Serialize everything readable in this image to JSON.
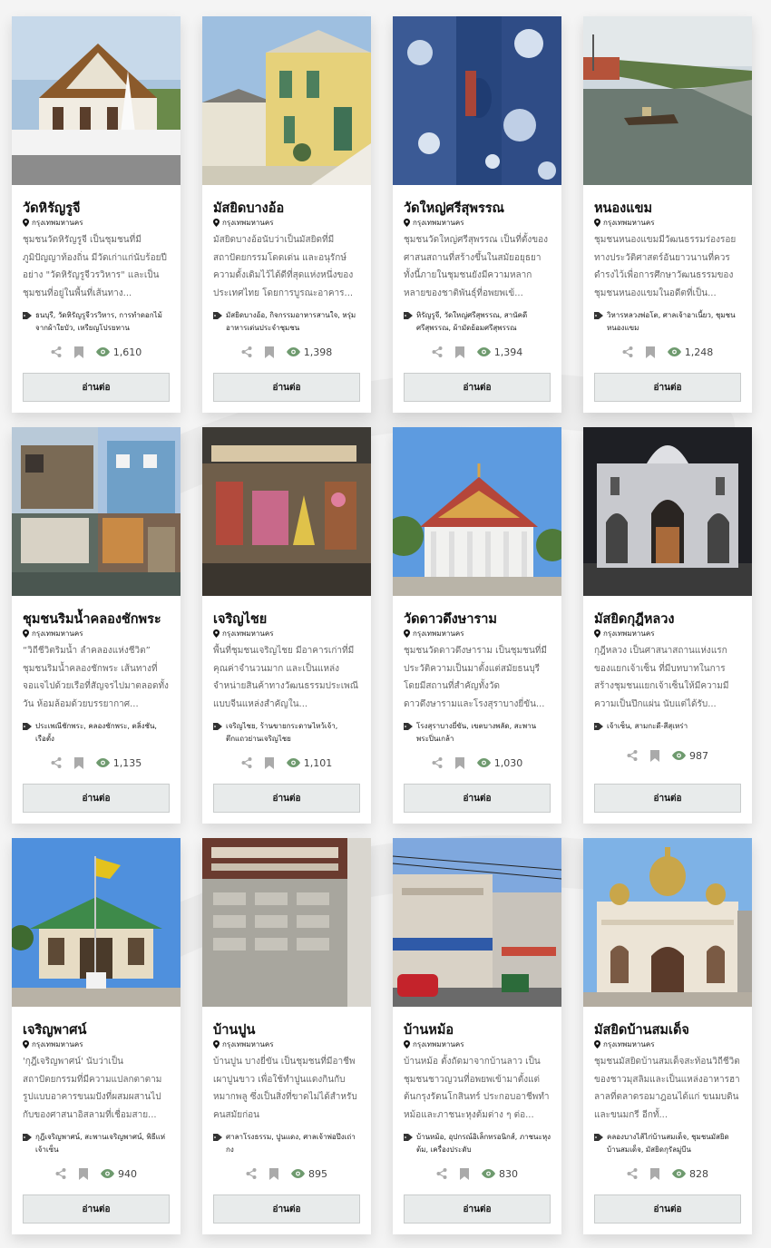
{
  "cards": [
    {
      "title": "วัดหิรัญรูจี",
      "location": "กรุงเทพมหานคร",
      "description": "ชุมชนวัดหิรัญรูจี เป็นชุมชนที่มีภูมิปัญญาท้องถิ่น มีวัดเก่าแก่นับร้อยปี อย่าง \"วัดหิรัญรูจีวรวิหาร\" และเป็นชุมชนที่อยู่ในพื้นที่เส้นทาง...",
      "tags": "ธนบุรี, วัดหิรัญรูจีวรวิหาร, การทำดอกไม้จากผ้าใยบัว, เหรียญโปรยทาน",
      "views": "1,610",
      "button": "อ่านต่อ"
    },
    {
      "title": "มัสยิดบางอ้อ",
      "location": "กรุงเทพมหานคร",
      "description": "มัสยิดบางอ้อนับว่าเป็นมัสยิดที่มีสถาปัตยกรรมโดดเด่น และอนุรักษ์ความดั้งเดิมไว้ได้ดีที่สุดแห่งหนึ่งของประเทศไทย โดยการบูรณะอาคาร...",
      "tags": "มัสยิดบางอ้อ, กิจกรรมอาหารสานใจ, หรุ่มอาหารเด่นประจำชุมชน",
      "views": "1,398",
      "button": "อ่านต่อ"
    },
    {
      "title": "วัดใหญ่ศรีสุพรรณ",
      "location": "กรุงเทพมหานคร",
      "description": "ชุมชนวัดใหญ่ศรีสุพรรณ เป็นที่ตั้งของศาสนสถานที่สร้างขึ้นในสมัยอยุธยา ทั้งนี้ภายในชุมชนยังมีความหลากหลายของชาติพันธุ์ที่อพยพเข้...",
      "tags": "หิรัญรูจี, วัดใหญ่ศรีสุพรรณ, สานัคดีศรีสุพรรณ, ผ้ามัดย้อมศรีสุพรรณ",
      "views": "1,394",
      "button": "อ่านต่อ"
    },
    {
      "title": "หนองแขม",
      "location": "กรุงเทพมหานคร",
      "description": "ชุมชนหนองแขมมีวัฒนธรรมร่องรอยทางประวัติศาสตร์อันยาวนานที่ควรดำรงไว้เพื่อการศึกษาวัฒนธรรมของชุมชนหนองแขมในอดีตที่เป็น...",
      "tags": "วิหารหลวงพ่อโต, ศาลเจ้าอาเนี้ยว, ชุมชนหนองแขม",
      "views": "1,248",
      "button": "อ่านต่อ"
    },
    {
      "title": "ชุมชนริมน้ำคลองชักพระ",
      "location": "กรุงเทพมหานคร",
      "description": "“วิถีชีวิตริมน้ำ ลำคลองแห่งชีวิต” ชุมชนริมน้ำคลองชักพระ เส้นทางที่จอแจไปด้วยเรือที่สัญจรไปมาตลอดทั้งวัน ห้อมล้อมด้วยบรรยากาศ...",
      "tags": "ประเพณีชักพระ, คลองชักพระ, ตลิ่งชัน, เรือตั้ง",
      "views": "1,135",
      "button": "อ่านต่อ"
    },
    {
      "title": "เจริญไชย",
      "location": "กรุงเทพมหานคร",
      "description": "พื้นที่ชุมชนเจริญไชย มีอาคารเก่าที่มีคุณค่าจำนวนมาก และเป็นแหล่งจำหน่ายสินค้าทางวัฒนธรรมประเพณีแบบจีนแหล่งสำคัญใน...",
      "tags": "เจริญไชย, ร้านขายกระดาษไหว้เจ้า, ตึกแถวย่านเจริญไชย",
      "views": "1,101",
      "button": "อ่านต่อ"
    },
    {
      "title": "วัดดาวดึงษาราม",
      "location": "กรุงเทพมหานคร",
      "description": "ชุมชนวัดดาวดึงษาราม เป็นชุมชนที่มีประวัติความเป็นมาตั้งแต่สมัยธนบุรี โดยมีสถานที่สำคัญทั้งวัดดาวดึงษารามและโรงสุราบางยี่ขัน...",
      "tags": "โรงสุราบางยี่ขัน, เขตบางพลัด, สะพานพระปิ่นเกล้า",
      "views": "1,030",
      "button": "อ่านต่อ"
    },
    {
      "title": "มัสยิดกุฎีหลวง",
      "location": "กรุงเทพมหานคร",
      "description": "กุฎีหลวง เป็นศาสนาสถานแห่งแรกของแยกเจ้าเซ็น ที่มีบทบาทในการสร้างชุมชนแยกเจ้าเซ็นให้มีความมีความเป็นปึกแผ่น นับแต่ได้รับ...",
      "tags": "เจ้าเซ็น, สามกะดี-สีสุเหร่า",
      "views": "987",
      "button": "อ่านต่อ"
    },
    {
      "title": "เจริญพาศน์",
      "location": "กรุงเทพมหานคร",
      "description": "'กุฎีเจริญพาศน์' นับว่าเป็นสถาปัตยกรรมที่มีความแปลกตาตามรูปแบบอาคารขนมปังที่ผสมผสานไปกับของศาสนาอิสลามที่เชื่อมสาย...",
      "tags": "กุฎีเจริญพาศน์, สะพานเจริญพาศน์, พิธีแห่เจ้าเซ็น",
      "views": "940",
      "button": "อ่านต่อ"
    },
    {
      "title": "บ้านปูน",
      "location": "กรุงเทพมหานคร",
      "description": "บ้านปูน บางยี่ขัน เป็นชุมชนที่มีอาชีพเผาปูนขาว เพื่อใช้ทำปูนแดงกินกับหมากพลู ซึ่งเป็นสิ่งที่ขาดไม่ได้สำหรับคนสมัยก่อน",
      "tags": "ศาลาโรงธรรม, ปูนแดง, ศาลเจ้าพ่อปึงเถ่ากง",
      "views": "895",
      "button": "อ่านต่อ"
    },
    {
      "title": "บ้านหม้อ",
      "location": "กรุงเทพมหานคร",
      "description": "บ้านหม้อ ตั้งถัดมาจากบ้านลาว เป็นชุมชนชาวญวนที่อพยพเข้ามาตั้งแต่ต้นกรุงรัตนโกสินทร์ ประกอบอาชีพทำหม้อและภาชนะหุงต้มต่าง ๆ ต่อ...",
      "tags": "บ้านหม้อ, อุปกรณ์อิเล็กทรอนิกส์, ภาชนะหุงต้ม, เครื่องประดับ",
      "views": "830",
      "button": "อ่านต่อ"
    },
    {
      "title": "มัสยิดบ้านสมเด็จ",
      "location": "กรุงเทพมหานคร",
      "description": "ชุมชนมัสยิดบ้านสมเด็จสะท้อนวิถีชีวิตของชาวมุสลิมและเป็นแหล่งอาหารฮาลาลที่ตลาดรอมาฎอนได้แก่ ขนมบดินและขนมกรี อีกทั้...",
      "tags": "คลองบางไส้ไก่บ้านสมเด็จ, ชุมชนมัสยิดบ้านสมเด็จ, มัสยิดกุรัลมู่บีน",
      "views": "828",
      "button": "อ่านต่อ"
    }
  ]
}
